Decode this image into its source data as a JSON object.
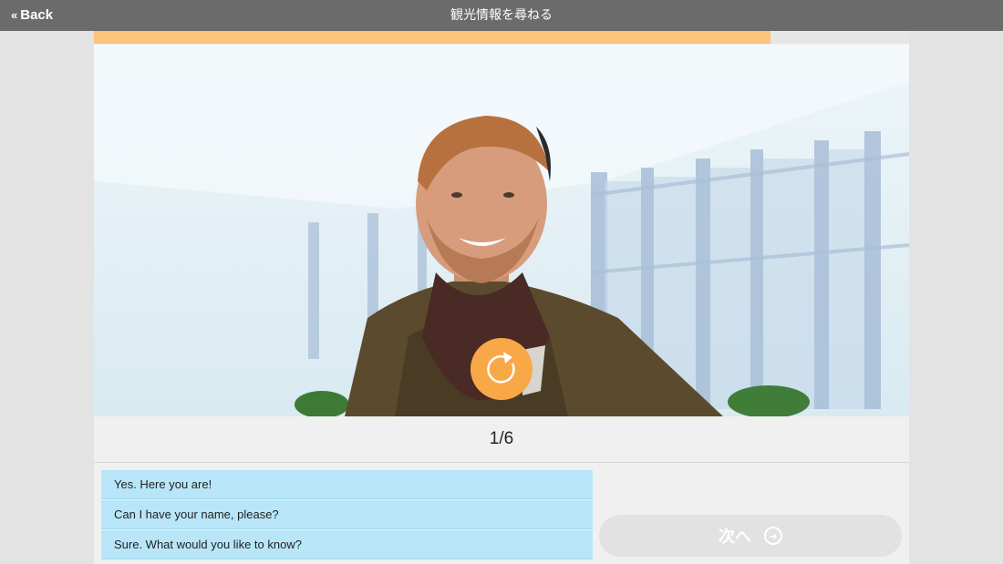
{
  "header": {
    "back_label": "Back",
    "title": "観光情報を尋ねる"
  },
  "progress": {
    "fraction": 0.83
  },
  "lesson": {
    "counter": "1/6"
  },
  "choices": [
    {
      "label": "Yes. Here you are!"
    },
    {
      "label": "Can I have your name, please?"
    },
    {
      "label": "Sure. What would you like to know?"
    }
  ],
  "next_button": {
    "label": "次へ",
    "icon": "arrow-right-circle-icon"
  },
  "replay_button": {
    "icon": "replay-icon"
  },
  "colors": {
    "accent": "#f9a848",
    "progress": "#fcc47d",
    "choice_bg": "#b8e6f8",
    "header_bg": "#6b6b6b"
  }
}
